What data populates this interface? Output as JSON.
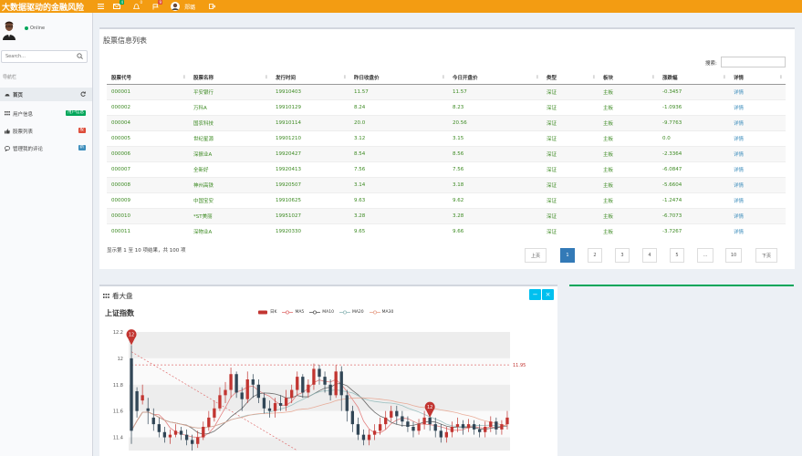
{
  "app": {
    "brand": "大数据驱动的金融风险",
    "username": "郑璐",
    "badges": {
      "mail": "4",
      "notify": "0",
      "flag": "9"
    }
  },
  "sidebar": {
    "status": "Online",
    "search_placeholder": "Search...",
    "nav_header": "导航栏",
    "items": [
      {
        "label": "首页",
        "icon": "dashboard-icon",
        "badge": ""
      },
      {
        "label": "用户信息",
        "icon": "grid-icon",
        "badge": "用户信息",
        "badge_color": "#00a65a"
      },
      {
        "label": "股票列表",
        "icon": "thumbs-up-icon",
        "badge": "股",
        "badge_color": "#dd4b39"
      },
      {
        "label": "管理我的评论",
        "icon": "comment-icon",
        "badge": "新",
        "badge_color": "#3c8dbc"
      }
    ]
  },
  "stock_panel": {
    "title": "股票信息列表",
    "search_label": "搜索:",
    "columns": [
      "股票代号",
      "股票名称",
      "发行时间",
      "昨日收盘价",
      "今日开盘价",
      "类型",
      "板块",
      "涨跌幅",
      "详情"
    ],
    "rows": [
      [
        "000001",
        "平安银行",
        "19910403",
        "11.57",
        "11.57",
        "深证",
        "主板",
        "-0.3457",
        "详情"
      ],
      [
        "000002",
        "万科A",
        "19910129",
        "8.24",
        "8.23",
        "深证",
        "主板",
        "-1.0936",
        "详情"
      ],
      [
        "000004",
        "国农科技",
        "19910114",
        "20.0",
        "20.56",
        "深证",
        "主板",
        "-9.7763",
        "详情"
      ],
      [
        "000005",
        "世纪星源",
        "19901210",
        "3.12",
        "3.15",
        "深证",
        "主板",
        "0.0",
        "详情"
      ],
      [
        "000006",
        "深振业A",
        "19920427",
        "8.54",
        "8.56",
        "深证",
        "主板",
        "-2.3364",
        "详情"
      ],
      [
        "000007",
        "全新好",
        "19920413",
        "7.56",
        "7.56",
        "深证",
        "主板",
        "-6.0847",
        "详情"
      ],
      [
        "000008",
        "神州高铁",
        "19920507",
        "3.14",
        "3.18",
        "深证",
        "主板",
        "-5.6604",
        "详情"
      ],
      [
        "000009",
        "中国宝安",
        "19910625",
        "9.63",
        "9.62",
        "深证",
        "主板",
        "-1.2474",
        "详情"
      ],
      [
        "000010",
        "*ST美丽",
        "19951027",
        "3.28",
        "3.28",
        "深证",
        "主板",
        "-6.7073",
        "详情"
      ],
      [
        "000011",
        "深物业A",
        "19920330",
        "9.65",
        "9.66",
        "深证",
        "主板",
        "-3.7267",
        "详情"
      ]
    ],
    "info": "显示第 1 至 10 项结果，共 100 项",
    "pagination": [
      "上页",
      "1",
      "2",
      "3",
      "4",
      "5",
      "...",
      "10",
      "下页"
    ],
    "active_page": "1"
  },
  "chart_panel": {
    "header": "看大盘",
    "minimize": "−",
    "close": "×",
    "legend": [
      {
        "name": "日K",
        "color": "#c23531"
      },
      {
        "name": "MA5",
        "color": "#e07070"
      },
      {
        "name": "MA10",
        "color": "#555555"
      },
      {
        "name": "MA20",
        "color": "#8fb8b8"
      },
      {
        "name": "MA30",
        "color": "#e6a08a"
      }
    ]
  },
  "chart_data": {
    "type": "candlestick",
    "title": "上证指数",
    "ylim": [
      11.3,
      12.2
    ],
    "yticks": [
      "12.2",
      "12",
      "11.8",
      "11.6",
      "11.4"
    ],
    "markline_label": "11.95",
    "markline_value": 11.95,
    "markpoints": [
      {
        "label": "12",
        "index": 0,
        "value": 12.1
      },
      {
        "label": "12",
        "index": 54,
        "value": 11.55
      }
    ],
    "up_color": "#c23531",
    "down_color": "#314656",
    "candles": [
      [
        12.0,
        11.45,
        11.35,
        12.1
      ],
      [
        11.75,
        11.6,
        11.55,
        11.78
      ],
      [
        11.68,
        11.72,
        11.65,
        11.8
      ],
      [
        11.62,
        11.6,
        11.5,
        11.7
      ],
      [
        11.55,
        11.5,
        11.45,
        11.62
      ],
      [
        11.5,
        11.44,
        11.4,
        11.55
      ],
      [
        11.44,
        11.4,
        11.36,
        11.48
      ],
      [
        11.4,
        11.42,
        11.35,
        11.46
      ],
      [
        11.42,
        11.45,
        11.4,
        11.5
      ],
      [
        11.45,
        11.42,
        11.38,
        11.48
      ],
      [
        11.42,
        11.38,
        11.34,
        11.46
      ],
      [
        11.38,
        11.35,
        11.3,
        11.42
      ],
      [
        11.35,
        11.4,
        11.32,
        11.45
      ],
      [
        11.4,
        11.48,
        11.38,
        11.52
      ],
      [
        11.48,
        11.55,
        11.45,
        11.6
      ],
      [
        11.55,
        11.62,
        11.52,
        11.68
      ],
      [
        11.62,
        11.72,
        11.6,
        11.78
      ],
      [
        11.72,
        11.76,
        11.66,
        11.82
      ],
      [
        11.76,
        11.88,
        11.7,
        11.93
      ],
      [
        11.88,
        11.74,
        11.7,
        11.9
      ],
      [
        11.74,
        11.69,
        11.6,
        11.78
      ],
      [
        11.69,
        11.84,
        11.66,
        11.9
      ],
      [
        11.84,
        11.8,
        11.7,
        11.88
      ],
      [
        11.8,
        11.7,
        11.66,
        11.84
      ],
      [
        11.7,
        11.62,
        11.58,
        11.74
      ],
      [
        11.62,
        11.6,
        11.55,
        11.68
      ],
      [
        11.6,
        11.66,
        11.55,
        11.7
      ],
      [
        11.66,
        11.64,
        11.6,
        11.72
      ],
      [
        11.64,
        11.7,
        11.6,
        11.76
      ],
      [
        11.7,
        11.76,
        11.66,
        11.8
      ],
      [
        11.76,
        11.86,
        11.72,
        11.9
      ],
      [
        11.86,
        11.74,
        11.7,
        11.88
      ],
      [
        11.74,
        11.8,
        11.7,
        11.84
      ],
      [
        11.8,
        11.92,
        11.76,
        11.96
      ],
      [
        11.92,
        11.86,
        11.8,
        11.95
      ],
      [
        11.86,
        11.8,
        11.74,
        11.9
      ],
      [
        11.8,
        11.72,
        11.68,
        11.84
      ],
      [
        11.72,
        11.9,
        11.7,
        11.95
      ],
      [
        11.9,
        11.72,
        11.6,
        11.94
      ],
      [
        11.72,
        11.6,
        11.52,
        11.76
      ],
      [
        11.6,
        11.5,
        11.44,
        11.64
      ],
      [
        11.5,
        11.42,
        11.38,
        11.55
      ],
      [
        11.42,
        11.38,
        11.34,
        11.46
      ],
      [
        11.38,
        11.42,
        11.34,
        11.46
      ],
      [
        11.42,
        11.45,
        11.38,
        11.5
      ],
      [
        11.45,
        11.5,
        11.42,
        11.55
      ],
      [
        11.5,
        11.55,
        11.46,
        11.6
      ],
      [
        11.55,
        11.6,
        11.52,
        11.64
      ],
      [
        11.6,
        11.56,
        11.5,
        11.64
      ],
      [
        11.56,
        11.52,
        11.48,
        11.6
      ],
      [
        11.52,
        11.48,
        11.44,
        11.56
      ],
      [
        11.48,
        11.45,
        11.4,
        11.52
      ],
      [
        11.45,
        11.5,
        11.42,
        11.54
      ],
      [
        11.5,
        11.55,
        11.46,
        11.6
      ],
      [
        11.55,
        11.5,
        11.45,
        11.6
      ],
      [
        11.5,
        11.45,
        11.4,
        11.55
      ],
      [
        11.45,
        11.4,
        11.36,
        11.5
      ],
      [
        11.4,
        11.44,
        11.36,
        11.48
      ],
      [
        11.44,
        11.48,
        11.4,
        11.52
      ],
      [
        11.48,
        11.5,
        11.44,
        11.55
      ],
      [
        11.5,
        11.47,
        11.42,
        11.53
      ],
      [
        11.47,
        11.5,
        11.44,
        11.54
      ],
      [
        11.5,
        11.46,
        11.42,
        11.53
      ],
      [
        11.46,
        11.44,
        11.4,
        11.5
      ],
      [
        11.44,
        11.48,
        11.4,
        11.52
      ],
      [
        11.48,
        11.52,
        11.44,
        11.56
      ],
      [
        11.52,
        11.46,
        11.42,
        11.55
      ],
      [
        11.46,
        11.5,
        11.42,
        11.53
      ],
      [
        11.5,
        11.55,
        11.46,
        11.6
      ]
    ]
  }
}
